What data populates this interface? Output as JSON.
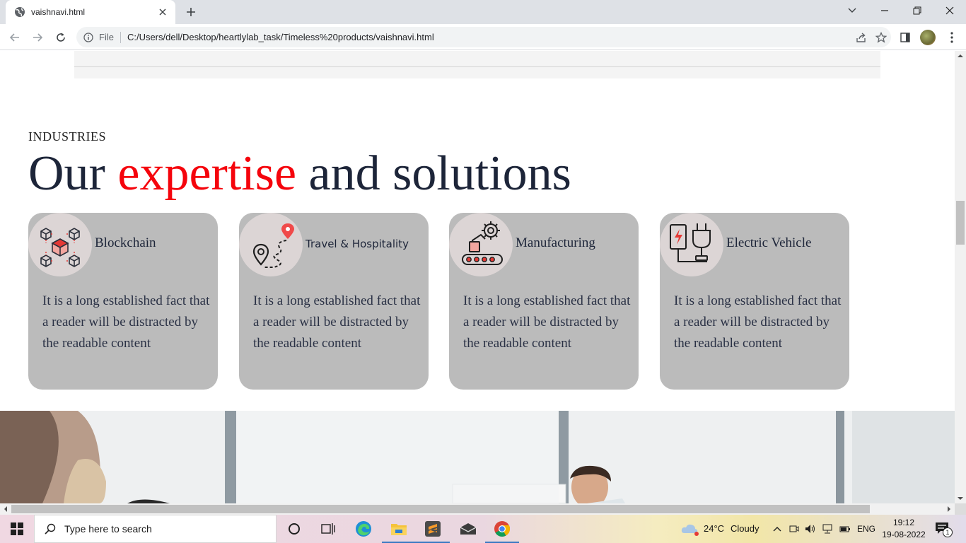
{
  "browser": {
    "tab_title": "vaishnavi.html",
    "address_scheme_label": "File",
    "url": "C:/Users/dell/Desktop/heartlylab_task/Timeless%20products/vaishnavi.html"
  },
  "page": {
    "eyebrow": "INDUSTRIES",
    "headline_before": "Our ",
    "headline_accent": "expertise",
    "headline_after": " and solutions",
    "accent_color": "#f5040c",
    "cards": [
      {
        "title": "Blockchain",
        "icon": "blockchain-icon",
        "body": "It is a long established fact that a reader will be distracted by the readable content"
      },
      {
        "title": "Travel & Hospitality",
        "icon": "travel-map-icon",
        "body": "It is a long established fact that a reader will be distracted by the readable content"
      },
      {
        "title": "Manufacturing",
        "icon": "manufacturing-conveyor-icon",
        "body": "It is a long established fact that a reader will be distracted by the readable content"
      },
      {
        "title": "Electric Vehicle",
        "icon": "ev-charger-icon",
        "body": "It is a long established fact that a reader will be distracted by the readable content"
      }
    ]
  },
  "taskbar": {
    "search_placeholder": "Type here to search",
    "weather_temp": "24°C",
    "weather_text": "Cloudy",
    "language": "ENG",
    "time": "19:12",
    "date": "19-08-2022",
    "notification_count": "1"
  }
}
